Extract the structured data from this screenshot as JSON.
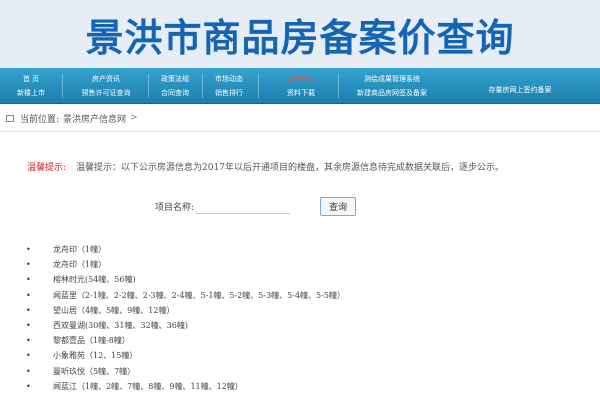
{
  "banner": {
    "title": "景洪市商品房备案价查询"
  },
  "nav": {
    "columns": [
      {
        "links": [
          "首 页",
          "新楼上市"
        ]
      },
      {
        "links": [
          "房产资讯",
          "预售许可证查询"
        ]
      },
      {
        "links": [
          "政策法规",
          "合同查询"
        ]
      },
      {
        "links": [
          "市场动态",
          "销售排行"
        ]
      },
      {
        "links": [
          "网签信息",
          "资料下载"
        ],
        "active_index": 0
      },
      {
        "links": [
          "测绘成果管理系统",
          "新建商品房网签及备案"
        ]
      },
      {
        "links": [
          "",
          "存量房网上签约备案"
        ]
      }
    ]
  },
  "breadcrumb": {
    "label": "当前位置:",
    "site": "景洪房产信息网",
    "arrow": ">"
  },
  "notice": {
    "label": "温馨提示:",
    "text": "温馨提示：以下公示房源信息为2017年以后开通项目的楼盘，其余房源信息待完成数据关联后，逐步公示。"
  },
  "search": {
    "label": "项目名称:",
    "value": "",
    "placeholder": "",
    "button_label": "查询"
  },
  "bullet_glyph": "•",
  "projects": [
    "龙舟印（1幢）",
    "龙舟印（1幢）",
    "榕林时光(54幢、56幢)",
    "闻蓝里（2-1幢、2-2幢、2-3幢、2-4幢、5-1幢、5-2幢、5-3幢、5-4幢、5-5幢）",
    "望山居（4幢、5幢、9幢、12幢）",
    "西双曼湖(30幢、31幢、32幢、36幢)",
    "黎都壹品（1幢-8幢）",
    "小象雅苑（12、15幢）",
    "曼听玖悦（5幢、7幢）",
    "闻蓝江（1幢、2幢、7幢、8幢、9幢、11幢、12幢）"
  ],
  "colors": {
    "banner_text": "#1565b5",
    "nav_bg": "#2591c0",
    "notice_label": "#e02020"
  }
}
